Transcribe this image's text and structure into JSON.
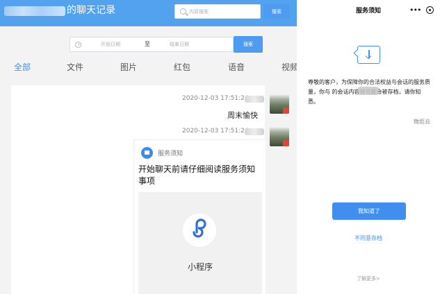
{
  "header": {
    "title": "的聊天记录",
    "search_placeholder": "内容搜索",
    "search_button": "搜索"
  },
  "date_filter": {
    "start_placeholder": "开始日期",
    "separator": "至",
    "end_placeholder": "结束日期",
    "search_button": "搜索"
  },
  "tabs": [
    "全部",
    "文件",
    "图片",
    "红包",
    "语音",
    "视频"
  ],
  "messages": [
    {
      "time": "2020-12-03 17:51:24",
      "text": "周末愉快"
    },
    {
      "time": "2020-12-03 17:51:24"
    }
  ],
  "card": {
    "source": "服务须知",
    "title": "开始聊天前请仔细阅读服务须知事项",
    "thumb_label": "小程序"
  },
  "right_panel": {
    "title": "服务须知",
    "more_icon": "•••",
    "body": "尊敬的客户，为保障你的合法权益与会话的服务质量，你与        的会话内容将可能会被存档，请你知悉。",
    "signature": "微炬云",
    "agree_button": "我知道了",
    "disagree_link": "不同意存档",
    "learn_more": "了解更多>"
  },
  "colors": {
    "header_blue": "#52a2ef",
    "accent_blue": "#3f8ef0"
  }
}
